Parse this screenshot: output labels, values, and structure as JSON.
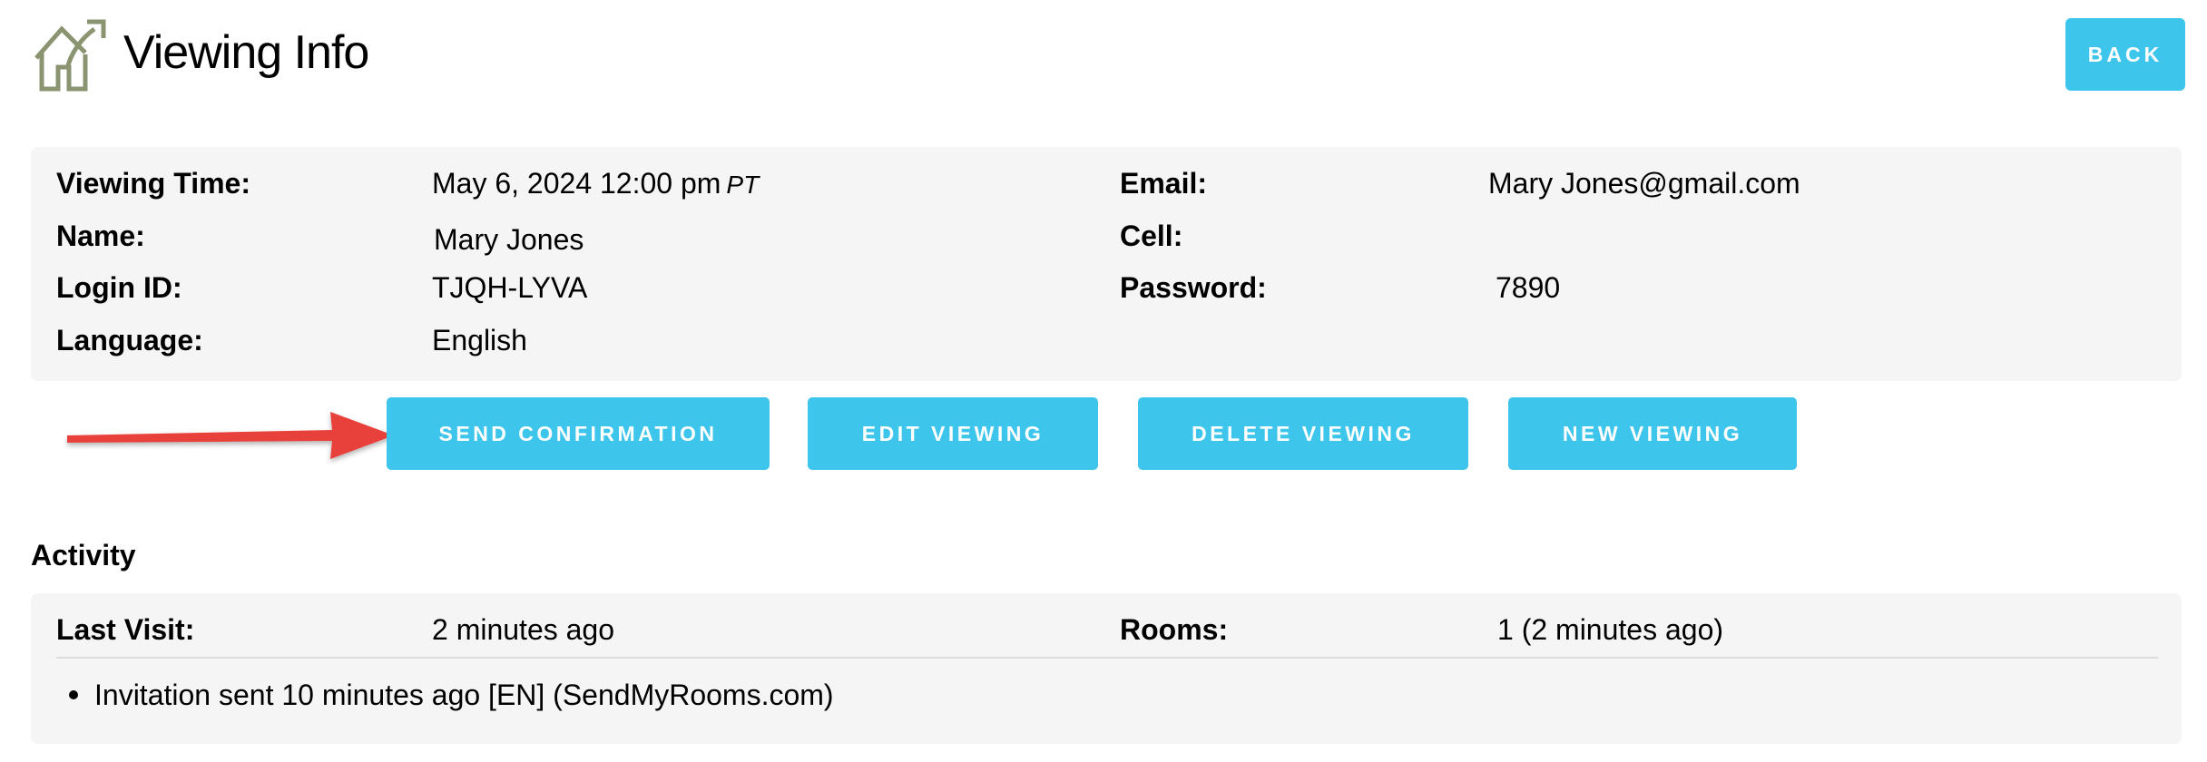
{
  "header": {
    "title": "Viewing Info",
    "logo_icon": "house-arrow-icon",
    "back_label": "BACK"
  },
  "viewing": {
    "labels": {
      "viewing_time": "Viewing Time:",
      "name": "Name:",
      "login_id": "Login ID:",
      "language": "Language:",
      "email": "Email:",
      "cell": "Cell:",
      "password": "Password:"
    },
    "values": {
      "viewing_time": "May 6, 2024 12:00 pm",
      "timezone": "PT",
      "name": "Mary Jones",
      "login_id": "TJQH-LYVA",
      "language": "English",
      "email": "Mary Jones@gmail.com",
      "cell": "",
      "password": "7890"
    }
  },
  "actions": {
    "send_confirmation": "SEND CONFIRMATION",
    "edit_viewing": "EDIT VIEWING",
    "delete_viewing": "DELETE VIEWING",
    "new_viewing": "NEW VIEWING"
  },
  "activity": {
    "title": "Activity",
    "last_visit_label": "Last Visit:",
    "last_visit_value": "2 minutes ago",
    "rooms_label": "Rooms:",
    "rooms_value": "1 (2 minutes ago)",
    "items": [
      "Invitation sent 10 minutes ago [EN] (SendMyRooms.com)"
    ]
  },
  "colors": {
    "button": "#3ec5ec",
    "panel": "#f5f5f5",
    "arrow": "#e8403b",
    "logo": "#8a9470"
  }
}
